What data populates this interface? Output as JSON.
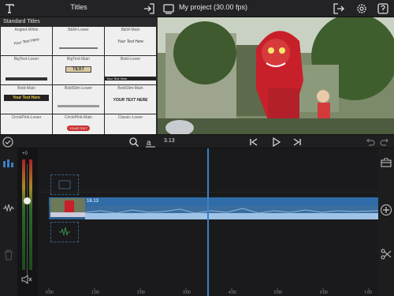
{
  "header": {
    "panel_title": "Titles",
    "project_title": "My project",
    "fps": "(30.00 fps)"
  },
  "titles": {
    "section": "Standard Titles",
    "tiles": [
      {
        "name": "Angled-White",
        "sample": "Your Text Here"
      },
      {
        "name": "B&W-Lower",
        "sample": ""
      },
      {
        "name": "B&W-Main",
        "sample": "Your Text Here"
      },
      {
        "name": "BigText-Lower",
        "sample": ""
      },
      {
        "name": "BigText-Main",
        "sample": "TEXT"
      },
      {
        "name": "Bold-Lower",
        "sample": "Your Text Here"
      },
      {
        "name": "Bold-Main",
        "sample": "Your Text Here"
      },
      {
        "name": "BoldSlim-Lower",
        "sample": ""
      },
      {
        "name": "BoldSlim-Main",
        "sample": "YOUR TEXT HERE"
      },
      {
        "name": "CirclePink-Lower",
        "sample": ""
      },
      {
        "name": "CirclePink-Main",
        "sample": "YOUR TEXT"
      },
      {
        "name": "Classic-Lower",
        "sample": ""
      }
    ]
  },
  "transport": {
    "zoom_value": "3.13"
  },
  "timeline": {
    "clip_duration": "16.13",
    "meter_top": "+0",
    "ruler": [
      "0.00",
      "1.00",
      "2.00",
      "3.00",
      "4.00",
      "5.00",
      "6.00",
      "7.00"
    ]
  },
  "colors": {
    "accent": "#3c7fc4",
    "clip": "#2f6ca8"
  }
}
